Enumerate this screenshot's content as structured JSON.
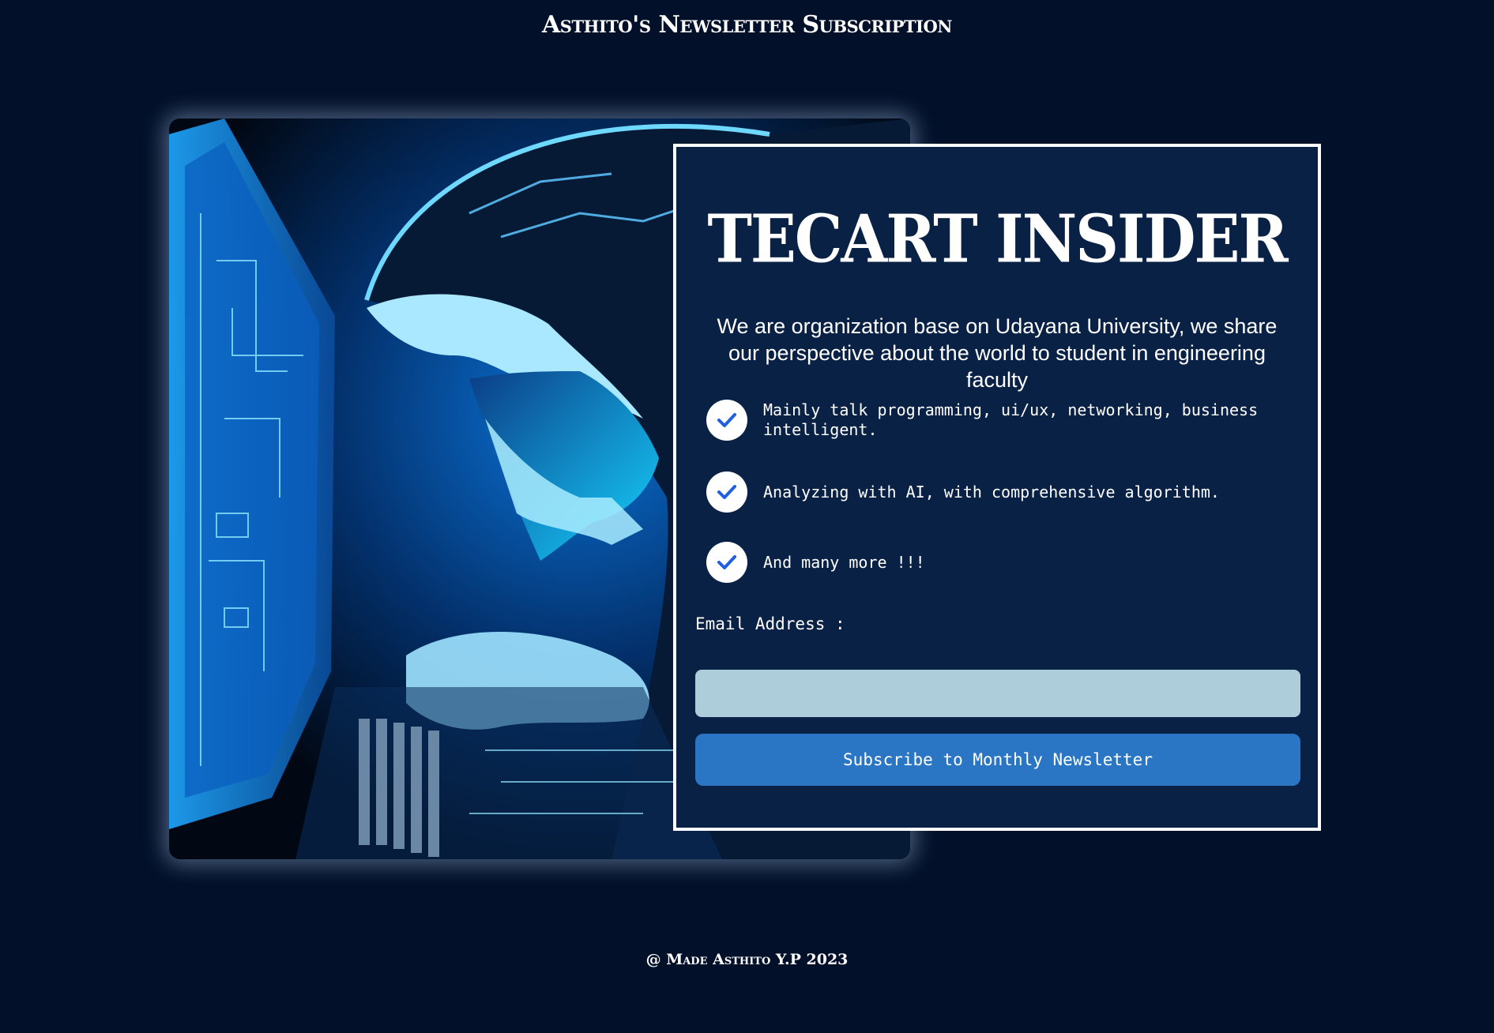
{
  "page": {
    "header_title": "Asthito's Newsletter Subscription",
    "footer_text": "@ Made Asthito Y.P 2023"
  },
  "hero": {
    "icon": "hooded-coder-illustration"
  },
  "card": {
    "brand": "TECART INSIDER",
    "description": "We are organization base on Udayana University, we share our perspective about the world to student in engineering faculty",
    "features": [
      {
        "icon": "check-icon",
        "text": "Mainly talk programming, ui/ux, networking, business intelligent."
      },
      {
        "icon": "check-icon",
        "text": "Analyzing with AI, with comprehensive algorithm."
      },
      {
        "icon": "check-icon",
        "text": "And many more !!!"
      }
    ],
    "email_label": "Email Address :",
    "email_value": "",
    "email_placeholder": "",
    "subscribe_label": "Subscribe to Monthly Newsletter"
  },
  "colors": {
    "background": "#021029",
    "card_background": "#0a2146",
    "accent_button": "#2a76c4",
    "input_background": "#aecdda",
    "check_color": "#1f5fe0",
    "neon_blue": "#1ec8ff"
  }
}
